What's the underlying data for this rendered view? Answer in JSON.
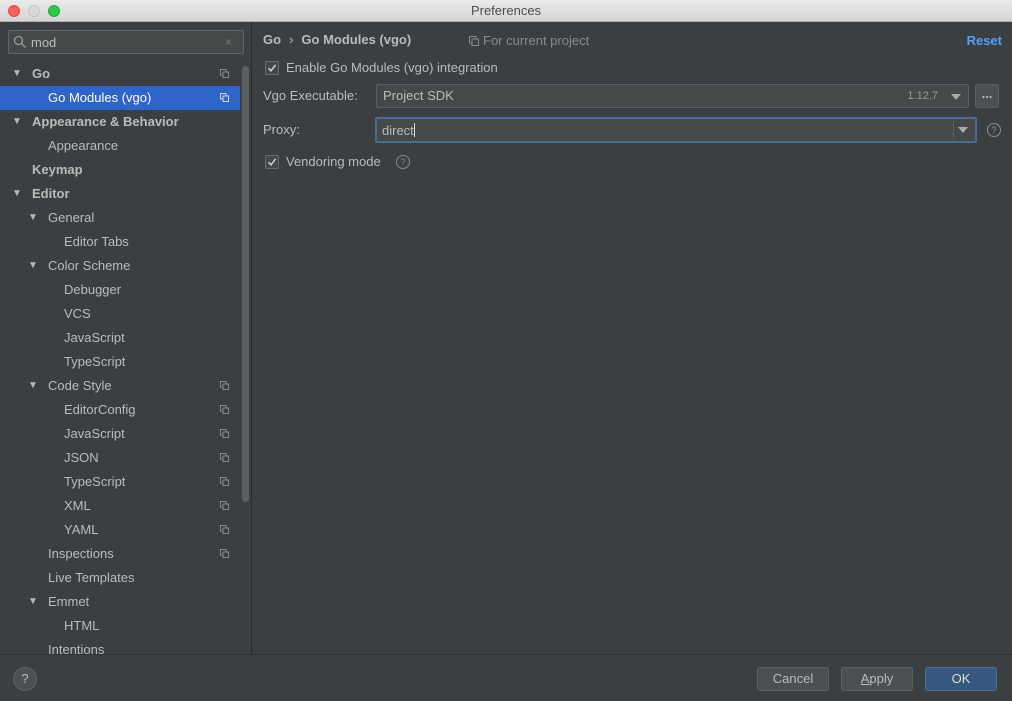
{
  "window": {
    "title": "Preferences"
  },
  "search": {
    "value": "mod",
    "clear": "×"
  },
  "tree": [
    {
      "label": "Go",
      "bold": true,
      "level": 0,
      "arrow": "▼",
      "project": true
    },
    {
      "label": "Go Modules (vgo)",
      "bold": false,
      "level": 1,
      "arrow": "",
      "project": true,
      "selected": true
    },
    {
      "label": "Appearance & Behavior",
      "bold": true,
      "level": 0,
      "arrow": "▼",
      "project": false
    },
    {
      "label": "Appearance",
      "bold": false,
      "level": 1,
      "arrow": "",
      "project": false
    },
    {
      "label": "Keymap",
      "bold": true,
      "level": 0,
      "arrow": "",
      "project": false
    },
    {
      "label": "Editor",
      "bold": true,
      "level": 0,
      "arrow": "▼",
      "project": false
    },
    {
      "label": "General",
      "bold": false,
      "level": 1,
      "arrow": "▼",
      "project": false
    },
    {
      "label": "Editor Tabs",
      "bold": false,
      "level": 2,
      "arrow": "",
      "project": false
    },
    {
      "label": "Color Scheme",
      "bold": false,
      "level": 1,
      "arrow": "▼",
      "project": false
    },
    {
      "label": "Debugger",
      "bold": false,
      "level": 2,
      "arrow": "",
      "project": false
    },
    {
      "label": "VCS",
      "bold": false,
      "level": 2,
      "arrow": "",
      "project": false
    },
    {
      "label": "JavaScript",
      "bold": false,
      "level": 2,
      "arrow": "",
      "project": false
    },
    {
      "label": "TypeScript",
      "bold": false,
      "level": 2,
      "arrow": "",
      "project": false
    },
    {
      "label": "Code Style",
      "bold": false,
      "level": 1,
      "arrow": "▼",
      "project": true
    },
    {
      "label": "EditorConfig",
      "bold": false,
      "level": 2,
      "arrow": "",
      "project": true
    },
    {
      "label": "JavaScript",
      "bold": false,
      "level": 2,
      "arrow": "",
      "project": true
    },
    {
      "label": "JSON",
      "bold": false,
      "level": 2,
      "arrow": "",
      "project": true
    },
    {
      "label": "TypeScript",
      "bold": false,
      "level": 2,
      "arrow": "",
      "project": true
    },
    {
      "label": "XML",
      "bold": false,
      "level": 2,
      "arrow": "",
      "project": true
    },
    {
      "label": "YAML",
      "bold": false,
      "level": 2,
      "arrow": "",
      "project": true
    },
    {
      "label": "Inspections",
      "bold": false,
      "level": 1,
      "arrow": "",
      "project": true
    },
    {
      "label": "Live Templates",
      "bold": false,
      "level": 1,
      "arrow": "",
      "project": false
    },
    {
      "label": "Emmet",
      "bold": false,
      "level": 1,
      "arrow": "▼",
      "project": false
    },
    {
      "label": "HTML",
      "bold": false,
      "level": 2,
      "arrow": "",
      "project": false
    },
    {
      "label": "Intentions",
      "bold": false,
      "level": 1,
      "arrow": "",
      "project": false
    }
  ],
  "breadcrumb": {
    "root": "Go",
    "sep": "›",
    "current": "Go Modules (vgo)"
  },
  "scope": {
    "label": "For current project"
  },
  "reset": {
    "label": "Reset"
  },
  "settings": {
    "enable_modules": {
      "label": "Enable Go Modules (vgo) integration",
      "checked": true
    },
    "vgo_executable": {
      "label": "Vgo Executable:",
      "value": "Project SDK",
      "version": "1.12.7",
      "browse": "..."
    },
    "proxy": {
      "label": "Proxy:",
      "value": "direct"
    },
    "vendoring": {
      "label": "Vendoring mode",
      "checked": true
    }
  },
  "footer": {
    "help": "?",
    "cancel": "Cancel",
    "apply_first": "A",
    "apply_rest": "pply",
    "ok": "OK"
  },
  "help_glyph": "?",
  "colors": {
    "selection": "#2f65ca",
    "accent": "#589df6",
    "primary_button": "#365880"
  }
}
